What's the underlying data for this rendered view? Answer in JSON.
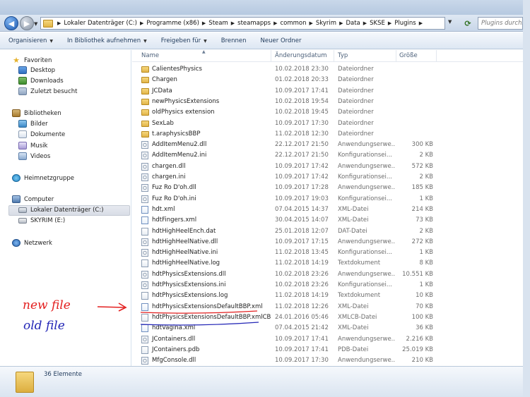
{
  "addressbar": {
    "breadcrumb": [
      "Lokaler Datenträger (C:)",
      "Programme (x86)",
      "Steam",
      "steamapps",
      "common",
      "Skyrim",
      "Data",
      "SKSE",
      "Plugins"
    ],
    "search_placeholder": "Plugins durchsuchen"
  },
  "toolbar": {
    "organize": "Organisieren",
    "include_library": "In Bibliothek aufnehmen",
    "share": "Freigeben für",
    "burn": "Brennen",
    "new_folder": "Neuer Ordner"
  },
  "nav": {
    "favorites": "Favoriten",
    "desktop": "Desktop",
    "downloads": "Downloads",
    "recent": "Zuletzt besucht",
    "libraries": "Bibliotheken",
    "pictures": "Bilder",
    "documents": "Dokumente",
    "music": "Musik",
    "videos": "Videos",
    "homegroup": "Heimnetzgruppe",
    "computer": "Computer",
    "local_disk": "Lokaler Datenträger (C:)",
    "skyrim_drive": "SKYRIM (E:)",
    "network": "Netzwerk"
  },
  "columns": {
    "name": "Name",
    "modified": "Änderungsdatum",
    "type": "Typ",
    "size": "Größe"
  },
  "files": [
    {
      "name": "CalientesPhysics",
      "date": "10.02.2018 23:30",
      "type": "Dateiordner",
      "size": "",
      "icon": "folder"
    },
    {
      "name": "Chargen",
      "date": "01.02.2018 20:33",
      "type": "Dateiordner",
      "size": "",
      "icon": "folder"
    },
    {
      "name": "JCData",
      "date": "10.09.2017 17:41",
      "type": "Dateiordner",
      "size": "",
      "icon": "folder"
    },
    {
      "name": "newPhysicsExtensions",
      "date": "10.02.2018 19:54",
      "type": "Dateiordner",
      "size": "",
      "icon": "folder"
    },
    {
      "name": "oldPhysics extension",
      "date": "10.02.2018 19:45",
      "type": "Dateiordner",
      "size": "",
      "icon": "folder"
    },
    {
      "name": "SexLab",
      "date": "10.09.2017 17:30",
      "type": "Dateiordner",
      "size": "",
      "icon": "folder"
    },
    {
      "name": "t.araphysicsBBP",
      "date": "11.02.2018 12:30",
      "type": "Dateiordner",
      "size": "",
      "icon": "folder"
    },
    {
      "name": "AddItemMenu2.dll",
      "date": "22.12.2017 21:50",
      "type": "Anwendungserwe...",
      "size": "300 KB",
      "icon": "gear"
    },
    {
      "name": "AddItemMenu2.ini",
      "date": "22.12.2017 21:50",
      "type": "Konfigurationsei...",
      "size": "2 KB",
      "icon": "gear"
    },
    {
      "name": "chargen.dll",
      "date": "10.09.2017 17:42",
      "type": "Anwendungserwe...",
      "size": "572 KB",
      "icon": "gear"
    },
    {
      "name": "chargen.ini",
      "date": "10.09.2017 17:42",
      "type": "Konfigurationsei...",
      "size": "2 KB",
      "icon": "gear"
    },
    {
      "name": "Fuz Ro D'oh.dll",
      "date": "10.09.2017 17:28",
      "type": "Anwendungserwe...",
      "size": "185 KB",
      "icon": "gear"
    },
    {
      "name": "Fuz Ro D'oh.ini",
      "date": "10.09.2017 19:03",
      "type": "Konfigurationsei...",
      "size": "1 KB",
      "icon": "gear"
    },
    {
      "name": "hdt.xml",
      "date": "07.04.2015 14:37",
      "type": "XML-Datei",
      "size": "214 KB",
      "icon": "xml"
    },
    {
      "name": "hdtFingers.xml",
      "date": "30.04.2015 14:07",
      "type": "XML-Datei",
      "size": "73 KB",
      "icon": "xml"
    },
    {
      "name": "hdtHighHeelEnch.dat",
      "date": "25.01.2018 12:07",
      "type": "DAT-Datei",
      "size": "2 KB",
      "icon": "file"
    },
    {
      "name": "hdtHighHeelNative.dll",
      "date": "10.09.2017 17:15",
      "type": "Anwendungserwe...",
      "size": "272 KB",
      "icon": "gear"
    },
    {
      "name": "hdtHighHeelNative.ini",
      "date": "11.02.2018 13:45",
      "type": "Konfigurationsei...",
      "size": "1 KB",
      "icon": "gear"
    },
    {
      "name": "hdtHighHeelNative.log",
      "date": "11.02.2018 14:19",
      "type": "Textdokument",
      "size": "8 KB",
      "icon": "file"
    },
    {
      "name": "hdtPhysicsExtensions.dll",
      "date": "10.02.2018 23:26",
      "type": "Anwendungserwe...",
      "size": "10.551 KB",
      "icon": "gear"
    },
    {
      "name": "hdtPhysicsExtensions.ini",
      "date": "10.02.2018 23:26",
      "type": "Konfigurationsei...",
      "size": "1 KB",
      "icon": "gear"
    },
    {
      "name": "hdtPhysicsExtensions.log",
      "date": "11.02.2018 14:19",
      "type": "Textdokument",
      "size": "10 KB",
      "icon": "file"
    },
    {
      "name": "hdtPhysicsExtensionsDefaultBBP.xml",
      "date": "11.02.2018 12:26",
      "type": "XML-Datei",
      "size": "70 KB",
      "icon": "xml"
    },
    {
      "name": "hdtPhysicsExtensionsDefaultBBP.xmlCB",
      "date": "24.01.2016 05:46",
      "type": "XMLCB-Datei",
      "size": "100 KB",
      "icon": "file"
    },
    {
      "name": "hdtVagina.xml",
      "date": "07.04.2015 21:42",
      "type": "XML-Datei",
      "size": "36 KB",
      "icon": "xml"
    },
    {
      "name": "JContainers.dll",
      "date": "10.09.2017 17:41",
      "type": "Anwendungserwe...",
      "size": "2.216 KB",
      "icon": "gear"
    },
    {
      "name": "JContainers.pdb",
      "date": "10.09.2017 17:41",
      "type": "PDB-Datei",
      "size": "25.019 KB",
      "icon": "file"
    },
    {
      "name": "MfgConsole.dll",
      "date": "10.09.2017 17:30",
      "type": "Anwendungserwe...",
      "size": "210 KB",
      "icon": "gear"
    }
  ],
  "status": {
    "count": "36 Elemente"
  },
  "annotations": {
    "new_file": "new file",
    "old_file": "old file",
    "new_color": "#e32020",
    "old_color": "#2326b6"
  }
}
